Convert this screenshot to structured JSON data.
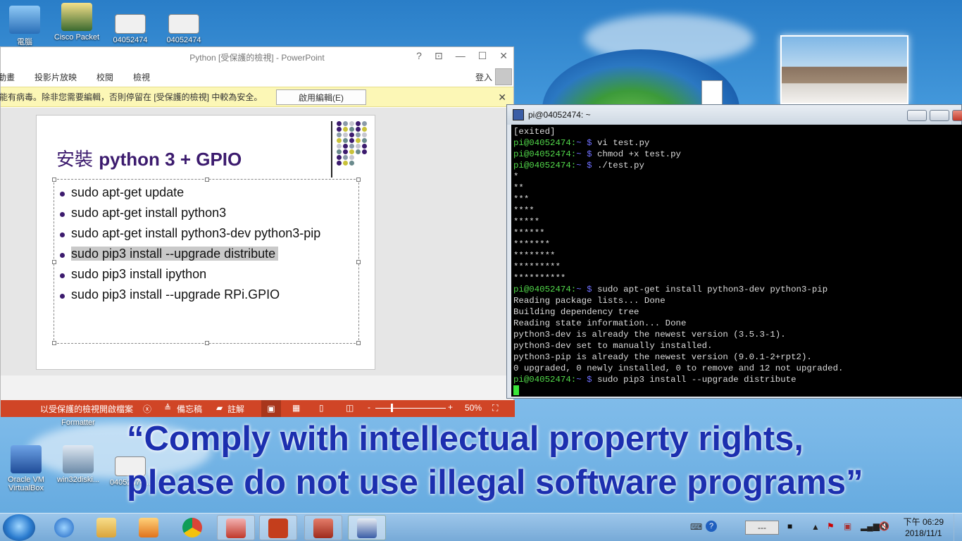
{
  "desktop": {
    "icons": [
      {
        "label": "電腦"
      },
      {
        "label": "Cisco Packet"
      },
      {
        "label": "04052474"
      },
      {
        "label": "04052474"
      },
      {
        "label": "Formatter"
      },
      {
        "label": "Oracle VM VirtualBox"
      },
      {
        "label": "win32diski..."
      },
      {
        "label": "04052474..."
      }
    ]
  },
  "powerpoint": {
    "title": "Python [受保護的檢視] - PowerPoint",
    "controls": {
      "help": "?",
      "restore_ribbon": "⊡",
      "minimize": "—",
      "maximize": "☐",
      "close": "✕"
    },
    "ribbon_tabs": [
      "動畫",
      "投影片放映",
      "校閱",
      "檢視"
    ],
    "login": "登入",
    "message_bar": {
      "text": "能有病毒。除非您需要編輯，否則停留在 [受保護的檢視] 中較為安全。",
      "enable_button": "啟用編輯(E)",
      "close": "✕"
    },
    "slide": {
      "title_cjk": "安裝 ",
      "title_latin": "python 3 + GPIO",
      "bullets": [
        "sudo apt-get update",
        "sudo apt-get install python3",
        "sudo apt-get install python3-dev python3-pip",
        "sudo pip3 install --upgrade distribute",
        "sudo pip3 install ipython",
        "sudo pip3 install --upgrade RPi.GPIO"
      ],
      "highlighted_index": 3
    },
    "status_bar": {
      "protected_text": "以受保護的檢視開啟檔案",
      "notes": "備忘稿",
      "comments": "註解",
      "zoom_minus": "-",
      "zoom_plus": "+",
      "zoom": "50%",
      "zoom_fraction": 0.5
    }
  },
  "putty": {
    "title": "pi@04052474: ~",
    "prompt_user": "pi@04052474:",
    "prompt_path": "~ $",
    "lines": [
      {
        "kind": "out",
        "text": "[exited]"
      },
      {
        "kind": "cmd",
        "text": " vi test.py"
      },
      {
        "kind": "cmd",
        "text": " chmod +x test.py"
      },
      {
        "kind": "cmd",
        "text": " ./test.py"
      },
      {
        "kind": "out",
        "text": "*"
      },
      {
        "kind": "out",
        "text": "**"
      },
      {
        "kind": "out",
        "text": "***"
      },
      {
        "kind": "out",
        "text": "****"
      },
      {
        "kind": "out",
        "text": "*****"
      },
      {
        "kind": "out",
        "text": "******"
      },
      {
        "kind": "out",
        "text": "*******"
      },
      {
        "kind": "out",
        "text": "********"
      },
      {
        "kind": "out",
        "text": "*********"
      },
      {
        "kind": "out",
        "text": "**********"
      },
      {
        "kind": "cmd",
        "text": " sudo apt-get install python3-dev python3-pip"
      },
      {
        "kind": "out",
        "text": "Reading package lists... Done"
      },
      {
        "kind": "out",
        "text": "Building dependency tree"
      },
      {
        "kind": "out",
        "text": "Reading state information... Done"
      },
      {
        "kind": "out",
        "text": "python3-dev is already the newest version (3.5.3-1)."
      },
      {
        "kind": "out",
        "text": "python3-dev set to manually installed."
      },
      {
        "kind": "out",
        "text": "python3-pip is already the newest version (9.0.1-2+rpt2)."
      },
      {
        "kind": "out",
        "text": "0 upgraded, 0 newly installed, 0 to remove and 12 not upgraded."
      },
      {
        "kind": "cmd",
        "text": " sudo pip3 install --upgrade distribute"
      }
    ]
  },
  "caption": {
    "line1": "“Comply with intellectual property rights,",
    "line2": "please do not use illegal software programs”"
  },
  "taskbar": {
    "tray_box": "---",
    "time": "下午 06:29",
    "date": "2018/11/1"
  },
  "colors": {
    "ppt_status": "#d04526",
    "prompt_green": "#52d84a",
    "prompt_blue": "#6f6fff",
    "caption_blue": "#1c2faf",
    "slide_title": "#3c1b6e"
  }
}
